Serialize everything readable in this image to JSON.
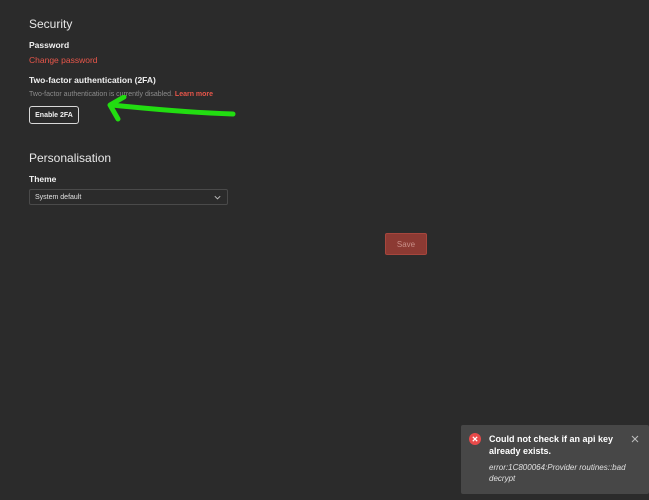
{
  "security": {
    "title": "Security",
    "password_label": "Password",
    "change_password": "Change password",
    "tfa_label": "Two-factor authentication (2FA)",
    "tfa_description": "Two-factor authentication is currently disabled.",
    "learn_more": "Learn more",
    "enable_button": "Enable 2FA"
  },
  "personalisation": {
    "title": "Personalisation",
    "theme_label": "Theme",
    "theme_value": "System default"
  },
  "save_label": "Save",
  "toast": {
    "title": "Could not check if an api key already exists.",
    "message": "error:1C800064:Provider routines::bad decrypt",
    "icon": "error-circle-icon"
  },
  "colors": {
    "background": "#2b2b2b",
    "accent": "#e8564a",
    "annotation": "#22dd11",
    "toast_bg": "#474747",
    "error_icon": "#e84a4a"
  }
}
